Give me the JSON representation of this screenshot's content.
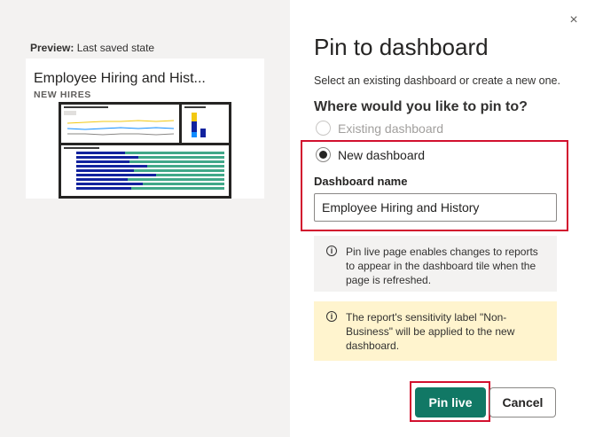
{
  "preview": {
    "caption_bold": "Preview:",
    "caption_rest": " Last saved state",
    "tile_title": "Employee Hiring and Hist...",
    "tile_subtitle": "NEW HIRES"
  },
  "dialog": {
    "title": "Pin to dashboard",
    "description": "Select an existing dashboard or create a new one.",
    "question": "Where would you like to pin to?",
    "options": [
      {
        "label": "Existing dashboard",
        "selected": false,
        "disabled": true
      },
      {
        "label": "New dashboard",
        "selected": true,
        "disabled": false
      }
    ],
    "dashboard_name_label": "Dashboard name",
    "dashboard_name_value": "Employee Hiring and History",
    "info_live": "Pin live page enables changes to reports to appear in the dashboard tile when the page is refreshed.",
    "info_sensitivity": "The report's sensitivity label \"Non-Business\" will be applied to the new dashboard.",
    "primary_button": "Pin live",
    "secondary_button": "Cancel",
    "close_glyph": "×"
  },
  "icons": {
    "close": "close-icon",
    "info": "info-icon"
  },
  "colors": {
    "primary": "#117865",
    "highlight": "#d2102e",
    "warning_bg": "#fff4ce",
    "info_bg": "#f3f2f1"
  }
}
